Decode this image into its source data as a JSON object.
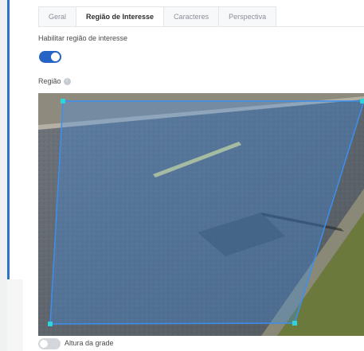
{
  "tabs": [
    {
      "label": "Geral",
      "active": false
    },
    {
      "label": "Região de Interesse",
      "active": true
    },
    {
      "label": "Caracteres",
      "active": false
    },
    {
      "label": "Perspectiva",
      "active": false
    }
  ],
  "enable_region": {
    "label": "Habilitar região de interesse",
    "enabled": true
  },
  "region": {
    "label": "Região",
    "info_icon": "info-icon"
  },
  "grid_height": {
    "label": "Altura da grade",
    "enabled": false
  },
  "colors": {
    "accent": "#2563c4",
    "region_stroke": "#3b8ff0",
    "handle": "#2fd3d8"
  }
}
